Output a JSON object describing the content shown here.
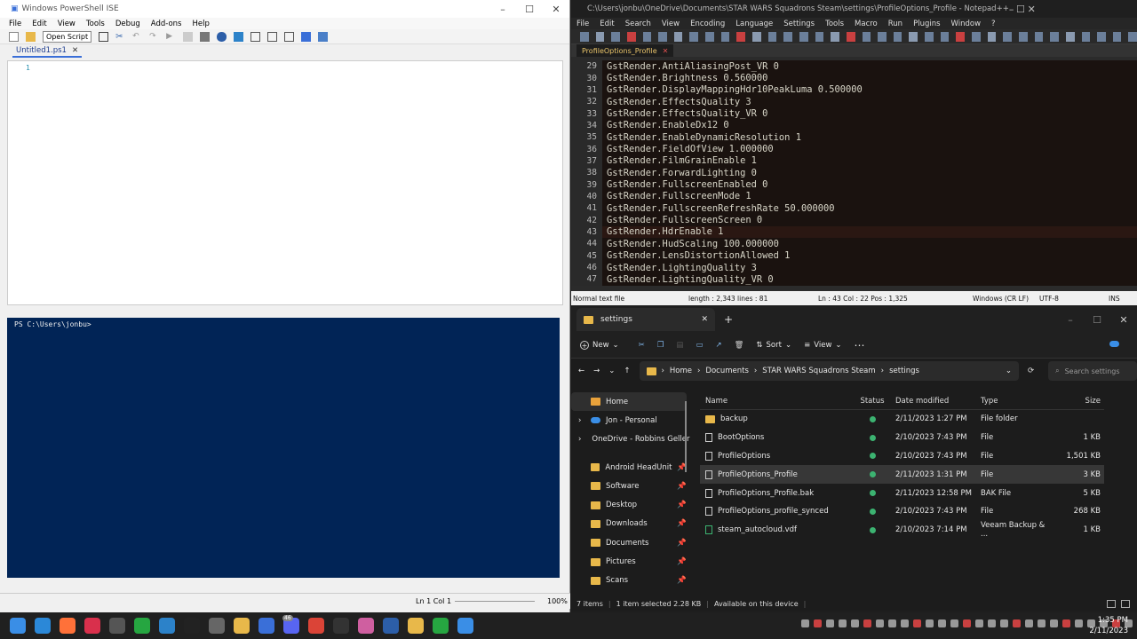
{
  "ise": {
    "title": "Windows PowerShell ISE",
    "menu": [
      "File",
      "Edit",
      "View",
      "Tools",
      "Debug",
      "Add-ons",
      "Help"
    ],
    "tooltip": "Open Script",
    "tab": "Untitled1.ps1",
    "line_number": "1",
    "prompt": "PS C:\\Users\\jonbu>",
    "status_pos": "Ln 1  Col 1",
    "zoom": "100%"
  },
  "npp": {
    "title": "C:\\Users\\jonbu\\OneDrive\\Documents\\STAR WARS Squadrons Steam\\settings\\ProfileOptions_Profile - Notepad++",
    "menu": [
      "File",
      "Edit",
      "Search",
      "View",
      "Encoding",
      "Language",
      "Settings",
      "Tools",
      "Macro",
      "Run",
      "Plugins",
      "Window",
      "?"
    ],
    "tab": "ProfileOptions_Profile",
    "lines": [
      {
        "n": "29",
        "t": "GstRender.AntiAliasingPost_VR 0"
      },
      {
        "n": "30",
        "t": "GstRender.Brightness 0.560000"
      },
      {
        "n": "31",
        "t": "GstRender.DisplayMappingHdr10PeakLuma 0.500000"
      },
      {
        "n": "32",
        "t": "GstRender.EffectsQuality 3"
      },
      {
        "n": "33",
        "t": "GstRender.EffectsQuality_VR 0"
      },
      {
        "n": "34",
        "t": "GstRender.EnableDx12 0"
      },
      {
        "n": "35",
        "t": "GstRender.EnableDynamicResolution 1"
      },
      {
        "n": "36",
        "t": "GstRender.FieldOfView 1.000000"
      },
      {
        "n": "37",
        "t": "GstRender.FilmGrainEnable 1"
      },
      {
        "n": "38",
        "t": "GstRender.ForwardLighting 0"
      },
      {
        "n": "39",
        "t": "GstRender.FullscreenEnabled 0"
      },
      {
        "n": "40",
        "t": "GstRender.FullscreenMode 1"
      },
      {
        "n": "41",
        "t": "GstRender.FullscreenRefreshRate 50.000000"
      },
      {
        "n": "42",
        "t": "GstRender.FullscreenScreen 0"
      },
      {
        "n": "43",
        "t": "GstRender.HdrEnable 1"
      },
      {
        "n": "44",
        "t": "GstRender.HudScaling 100.000000"
      },
      {
        "n": "45",
        "t": "GstRender.LensDistortionAllowed 1"
      },
      {
        "n": "46",
        "t": "GstRender.LightingQuality 3"
      },
      {
        "n": "47",
        "t": "GstRender.LightingQuality_VR 0"
      }
    ],
    "status": {
      "type": "Normal text file",
      "length": "length : 2,343    lines : 81",
      "pos": "Ln : 43    Col : 22    Pos : 1,325",
      "eol": "Windows (CR LF)",
      "enc": "UTF-8",
      "mode": "INS"
    }
  },
  "explorer": {
    "tab": "settings",
    "cmd": {
      "new": "New",
      "sort": "Sort",
      "view": "View"
    },
    "breadcrumb": [
      "Home",
      "Documents",
      "STAR WARS Squadrons Steam",
      "settings"
    ],
    "search_placeholder": "Search settings",
    "nav": [
      {
        "label": "Home",
        "kind": "home"
      },
      {
        "label": "Jon - Personal",
        "kind": "cloud"
      },
      {
        "label": "OneDrive - Robbins Geller",
        "kind": "cloud"
      },
      {
        "label": "Android HeadUnit",
        "kind": "folder"
      },
      {
        "label": "Software",
        "kind": "folder"
      },
      {
        "label": "Desktop",
        "kind": "folder"
      },
      {
        "label": "Downloads",
        "kind": "folder"
      },
      {
        "label": "Documents",
        "kind": "folder"
      },
      {
        "label": "Pictures",
        "kind": "folder"
      },
      {
        "label": "Scans",
        "kind": "folder"
      }
    ],
    "columns": [
      "Name",
      "Status",
      "Date modified",
      "Type",
      "Size"
    ],
    "files": [
      {
        "name": "backup",
        "date": "2/11/2023 1:27 PM",
        "type": "File folder",
        "size": "",
        "kind": "folder"
      },
      {
        "name": "BootOptions",
        "date": "2/10/2023 7:43 PM",
        "type": "File",
        "size": "1 KB",
        "kind": "file"
      },
      {
        "name": "ProfileOptions",
        "date": "2/10/2023 7:43 PM",
        "type": "File",
        "size": "1,501 KB",
        "kind": "file"
      },
      {
        "name": "ProfileOptions_Profile",
        "date": "2/11/2023 1:31 PM",
        "type": "File",
        "size": "3 KB",
        "kind": "file"
      },
      {
        "name": "ProfileOptions_Profile.bak",
        "date": "2/11/2023 12:58 PM",
        "type": "BAK File",
        "size": "5 KB",
        "kind": "file"
      },
      {
        "name": "ProfileOptions_profile_synced",
        "date": "2/10/2023 7:43 PM",
        "type": "File",
        "size": "268 KB",
        "kind": "file"
      },
      {
        "name": "steam_autocloud.vdf",
        "date": "2/10/2023 7:14 PM",
        "type": "Veeam Backup & ...",
        "size": "1 KB",
        "kind": "vdf"
      }
    ],
    "status": {
      "items": "7 items",
      "selected": "1 item selected  2.28 KB",
      "avail": "Available on this device"
    }
  },
  "taskbar": {
    "time": "1:35 PM",
    "date": "2/11/2023",
    "badge": "46"
  }
}
